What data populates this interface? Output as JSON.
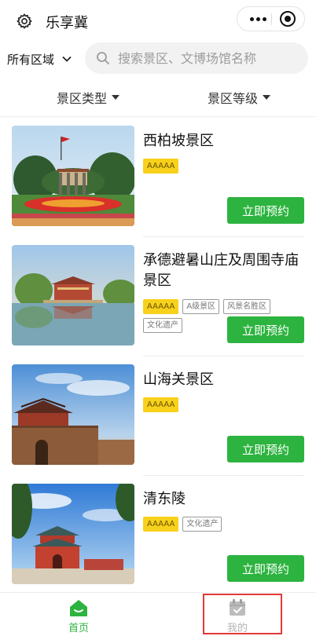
{
  "header": {
    "title": "乐享冀"
  },
  "search": {
    "region": "所有区域",
    "placeholder": "搜索景区、文博场馆名称"
  },
  "filters": {
    "type_label": "景区类型",
    "level_label": "景区等级"
  },
  "scenic_list": [
    {
      "name": "西柏坡景区",
      "tags": [
        "AAAAA"
      ],
      "book_label": "立即预约"
    },
    {
      "name": "承德避暑山庄及周围寺庙景区",
      "tags": [
        "AAAAA",
        "A级景区",
        "风景名胜区",
        "文化遗产"
      ],
      "book_label": "立即预约"
    },
    {
      "name": "山海关景区",
      "tags": [
        "AAAAA"
      ],
      "book_label": "立即预约"
    },
    {
      "name": "清东陵",
      "tags": [
        "AAAAA",
        "文化遗产"
      ],
      "book_label": "立即预约"
    }
  ],
  "tabbar": {
    "home_label": "首页",
    "mine_label": "我的"
  },
  "colors": {
    "accent_green": "#2db33f",
    "tag_yellow": "#f7d11b",
    "highlight_red": "#e53935"
  },
  "icons": {
    "settings": "gear-icon",
    "more": "more-dots-icon",
    "close": "target-circle-icon",
    "search": "search-icon",
    "region": "chevron-down-icon",
    "home": "home-icon",
    "mine": "calendar-check-icon"
  }
}
